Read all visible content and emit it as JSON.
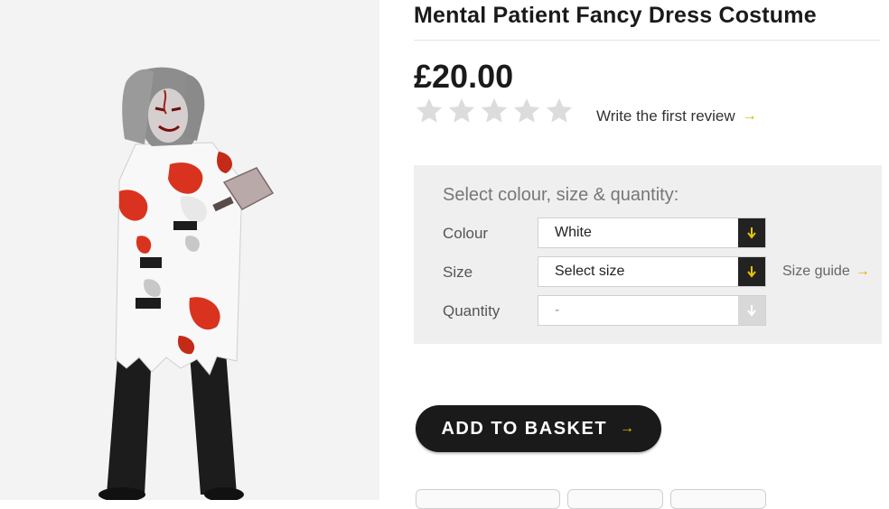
{
  "product": {
    "title": "Mental Patient Fancy Dress Costume",
    "price": "£20.00",
    "rating": 0,
    "rating_max": 5,
    "review_link": "Write the first review",
    "review_arrow": "→"
  },
  "options": {
    "heading": "Select colour, size & quantity:",
    "colour": {
      "label": "Colour",
      "value": "White"
    },
    "size": {
      "label": "Size",
      "value": "Select size"
    },
    "quantity": {
      "label": "Quantity",
      "value": "-"
    },
    "size_guide": "Size guide",
    "size_guide_arrow": "→"
  },
  "actions": {
    "add_to_basket": "ADD TO BASKET",
    "add_arrow": "→"
  },
  "icons": {
    "dropdown": "arrow-down-icon",
    "star": "star-icon",
    "arrow": "arrow-right-icon"
  },
  "colors": {
    "accent": "#d6b300",
    "button": "#1a1a1a",
    "star_empty": "#dcdcdc",
    "panel": "#efefef"
  }
}
